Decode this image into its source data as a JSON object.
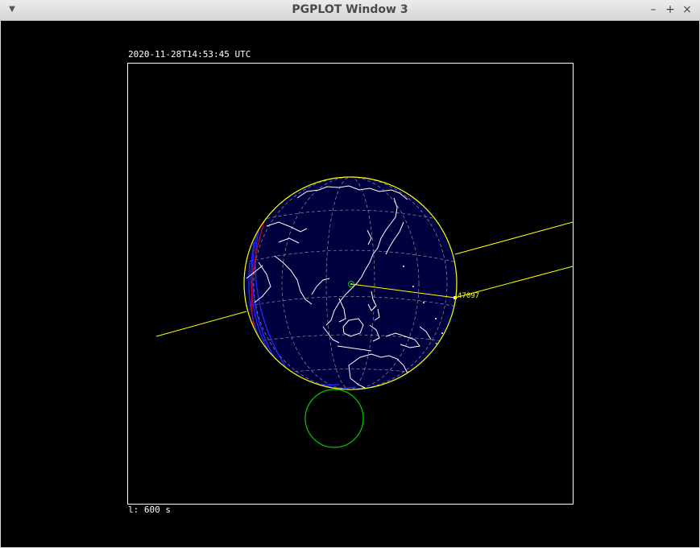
{
  "window": {
    "title": "PGPLOT Window 3",
    "menu_icon": "triangle-down-icon",
    "minimize_label": "–",
    "maximize_label": "+",
    "close_label": "×"
  },
  "plot": {
    "timestamp": "2020-11-28T14:53:45 UTC",
    "footer": "l: 600 s",
    "satellite_id": "47097",
    "colors": {
      "background": "#000000",
      "earth": "#000040",
      "frame": "#ffffff",
      "orbit": "#ffff00",
      "coast": "#ffffff",
      "terminator": "#2a2aff",
      "shadow": "#00cc00",
      "red_track": "#cc0000"
    }
  }
}
